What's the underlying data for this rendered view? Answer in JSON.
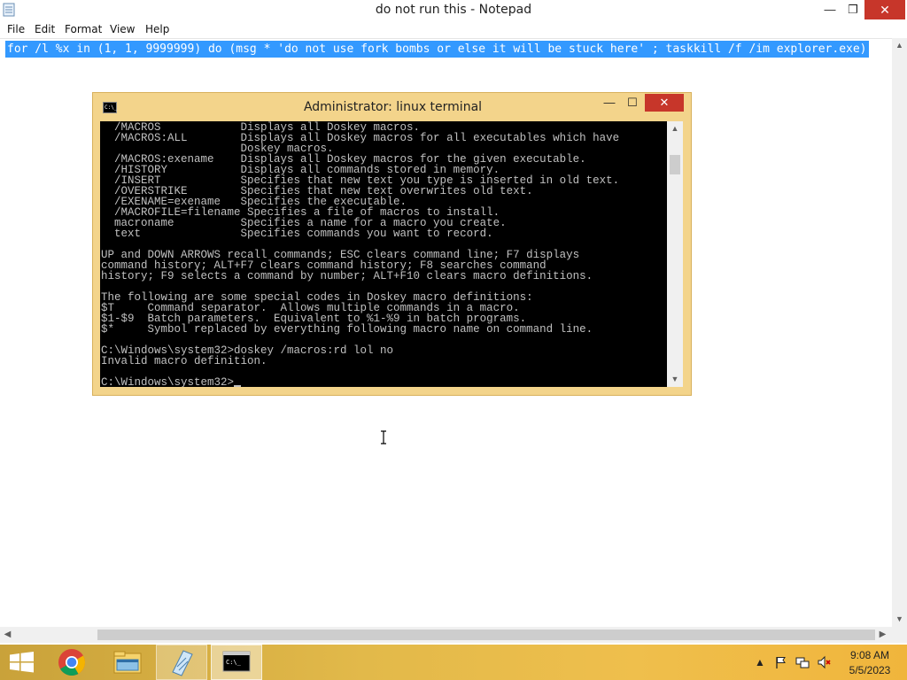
{
  "notepad": {
    "title": "do not run this - Notepad",
    "controls": {
      "minimize": "—",
      "maximize": "❐",
      "close": "✕"
    },
    "menu": [
      "File",
      "Edit",
      "Format",
      "View",
      "Help"
    ],
    "content_line": "for /l %x in (1, 1, 9999999) do (msg * 'do not use fork bombs or else it will be stuck here' ; taskkill /f /im explorer.exe)",
    "scroll_arrows": {
      "up": "▲",
      "down": "▼",
      "left": "◀",
      "right": "▶"
    }
  },
  "terminal": {
    "icon_label": "C:\\_",
    "title": "Administrator:  linux terminal",
    "controls": {
      "minimize": "—",
      "maximize": "☐",
      "close": "✕"
    },
    "lines": [
      "  /MACROS            Displays all Doskey macros.",
      "  /MACROS:ALL        Displays all Doskey macros for all executables which have",
      "                     Doskey macros.",
      "  /MACROS:exename    Displays all Doskey macros for the given executable.",
      "  /HISTORY           Displays all commands stored in memory.",
      "  /INSERT            Specifies that new text you type is inserted in old text.",
      "  /OVERSTRIKE        Specifies that new text overwrites old text.",
      "  /EXENAME=exename   Specifies the executable.",
      "  /MACROFILE=filename Specifies a file of macros to install.",
      "  macroname          Specifies a name for a macro you create.",
      "  text               Specifies commands you want to record.",
      "",
      "UP and DOWN ARROWS recall commands; ESC clears command line; F7 displays",
      "command history; ALT+F7 clears command history; F8 searches command",
      "history; F9 selects a command by number; ALT+F10 clears macro definitions.",
      "",
      "The following are some special codes in Doskey macro definitions:",
      "$T     Command separator.  Allows multiple commands in a macro.",
      "$1-$9  Batch parameters.  Equivalent to %1-%9 in batch programs.",
      "$*     Symbol replaced by everything following macro name on command line.",
      "",
      "C:\\Windows\\system32>doskey /macros:rd lol no",
      "Invalid macro definition.",
      ""
    ],
    "prompt": "C:\\Windows\\system32>",
    "scroll_arrows": {
      "up": "▲",
      "down": "▼"
    }
  },
  "taskbar": {
    "items": [
      "start-button",
      "chrome-icon",
      "file-explorer-icon",
      "notepad-icon",
      "command-prompt-icon"
    ],
    "tray": {
      "icons": [
        "show-hidden-icons-arrow",
        "action-center-flag-icon",
        "network-icon",
        "volume-muted-icon"
      ],
      "time": "9:08 AM",
      "date": "5/5/2023"
    }
  },
  "colors": {
    "selection": "#3399ff",
    "close_button": "#c7362a",
    "terminal_frame": "#f3d48b",
    "taskbar": "#e2b94a",
    "console_text": "#c0c0c0"
  }
}
